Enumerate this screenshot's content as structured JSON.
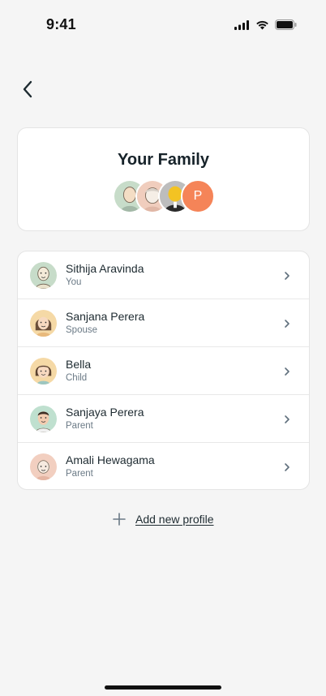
{
  "status": {
    "time": "9:41"
  },
  "family": {
    "title": "Your Family",
    "extra_avatar_letter": "P",
    "extra_avatar_color": "#f58458"
  },
  "members": [
    {
      "name": "Sithija Aravinda",
      "role": "You"
    },
    {
      "name": "Sanjana Perera",
      "role": "Spouse"
    },
    {
      "name": "Bella",
      "role": "Child"
    },
    {
      "name": "Sanjaya Perera",
      "role": "Parent"
    },
    {
      "name": "Amali Hewagama",
      "role": "Parent"
    }
  ],
  "add_profile": {
    "label": "Add new profile",
    "icon": "plus-icon"
  },
  "icons": [
    "back-arrow-icon",
    "chevron-right-icon",
    "signal-icon",
    "wifi-icon",
    "battery-icon"
  ]
}
